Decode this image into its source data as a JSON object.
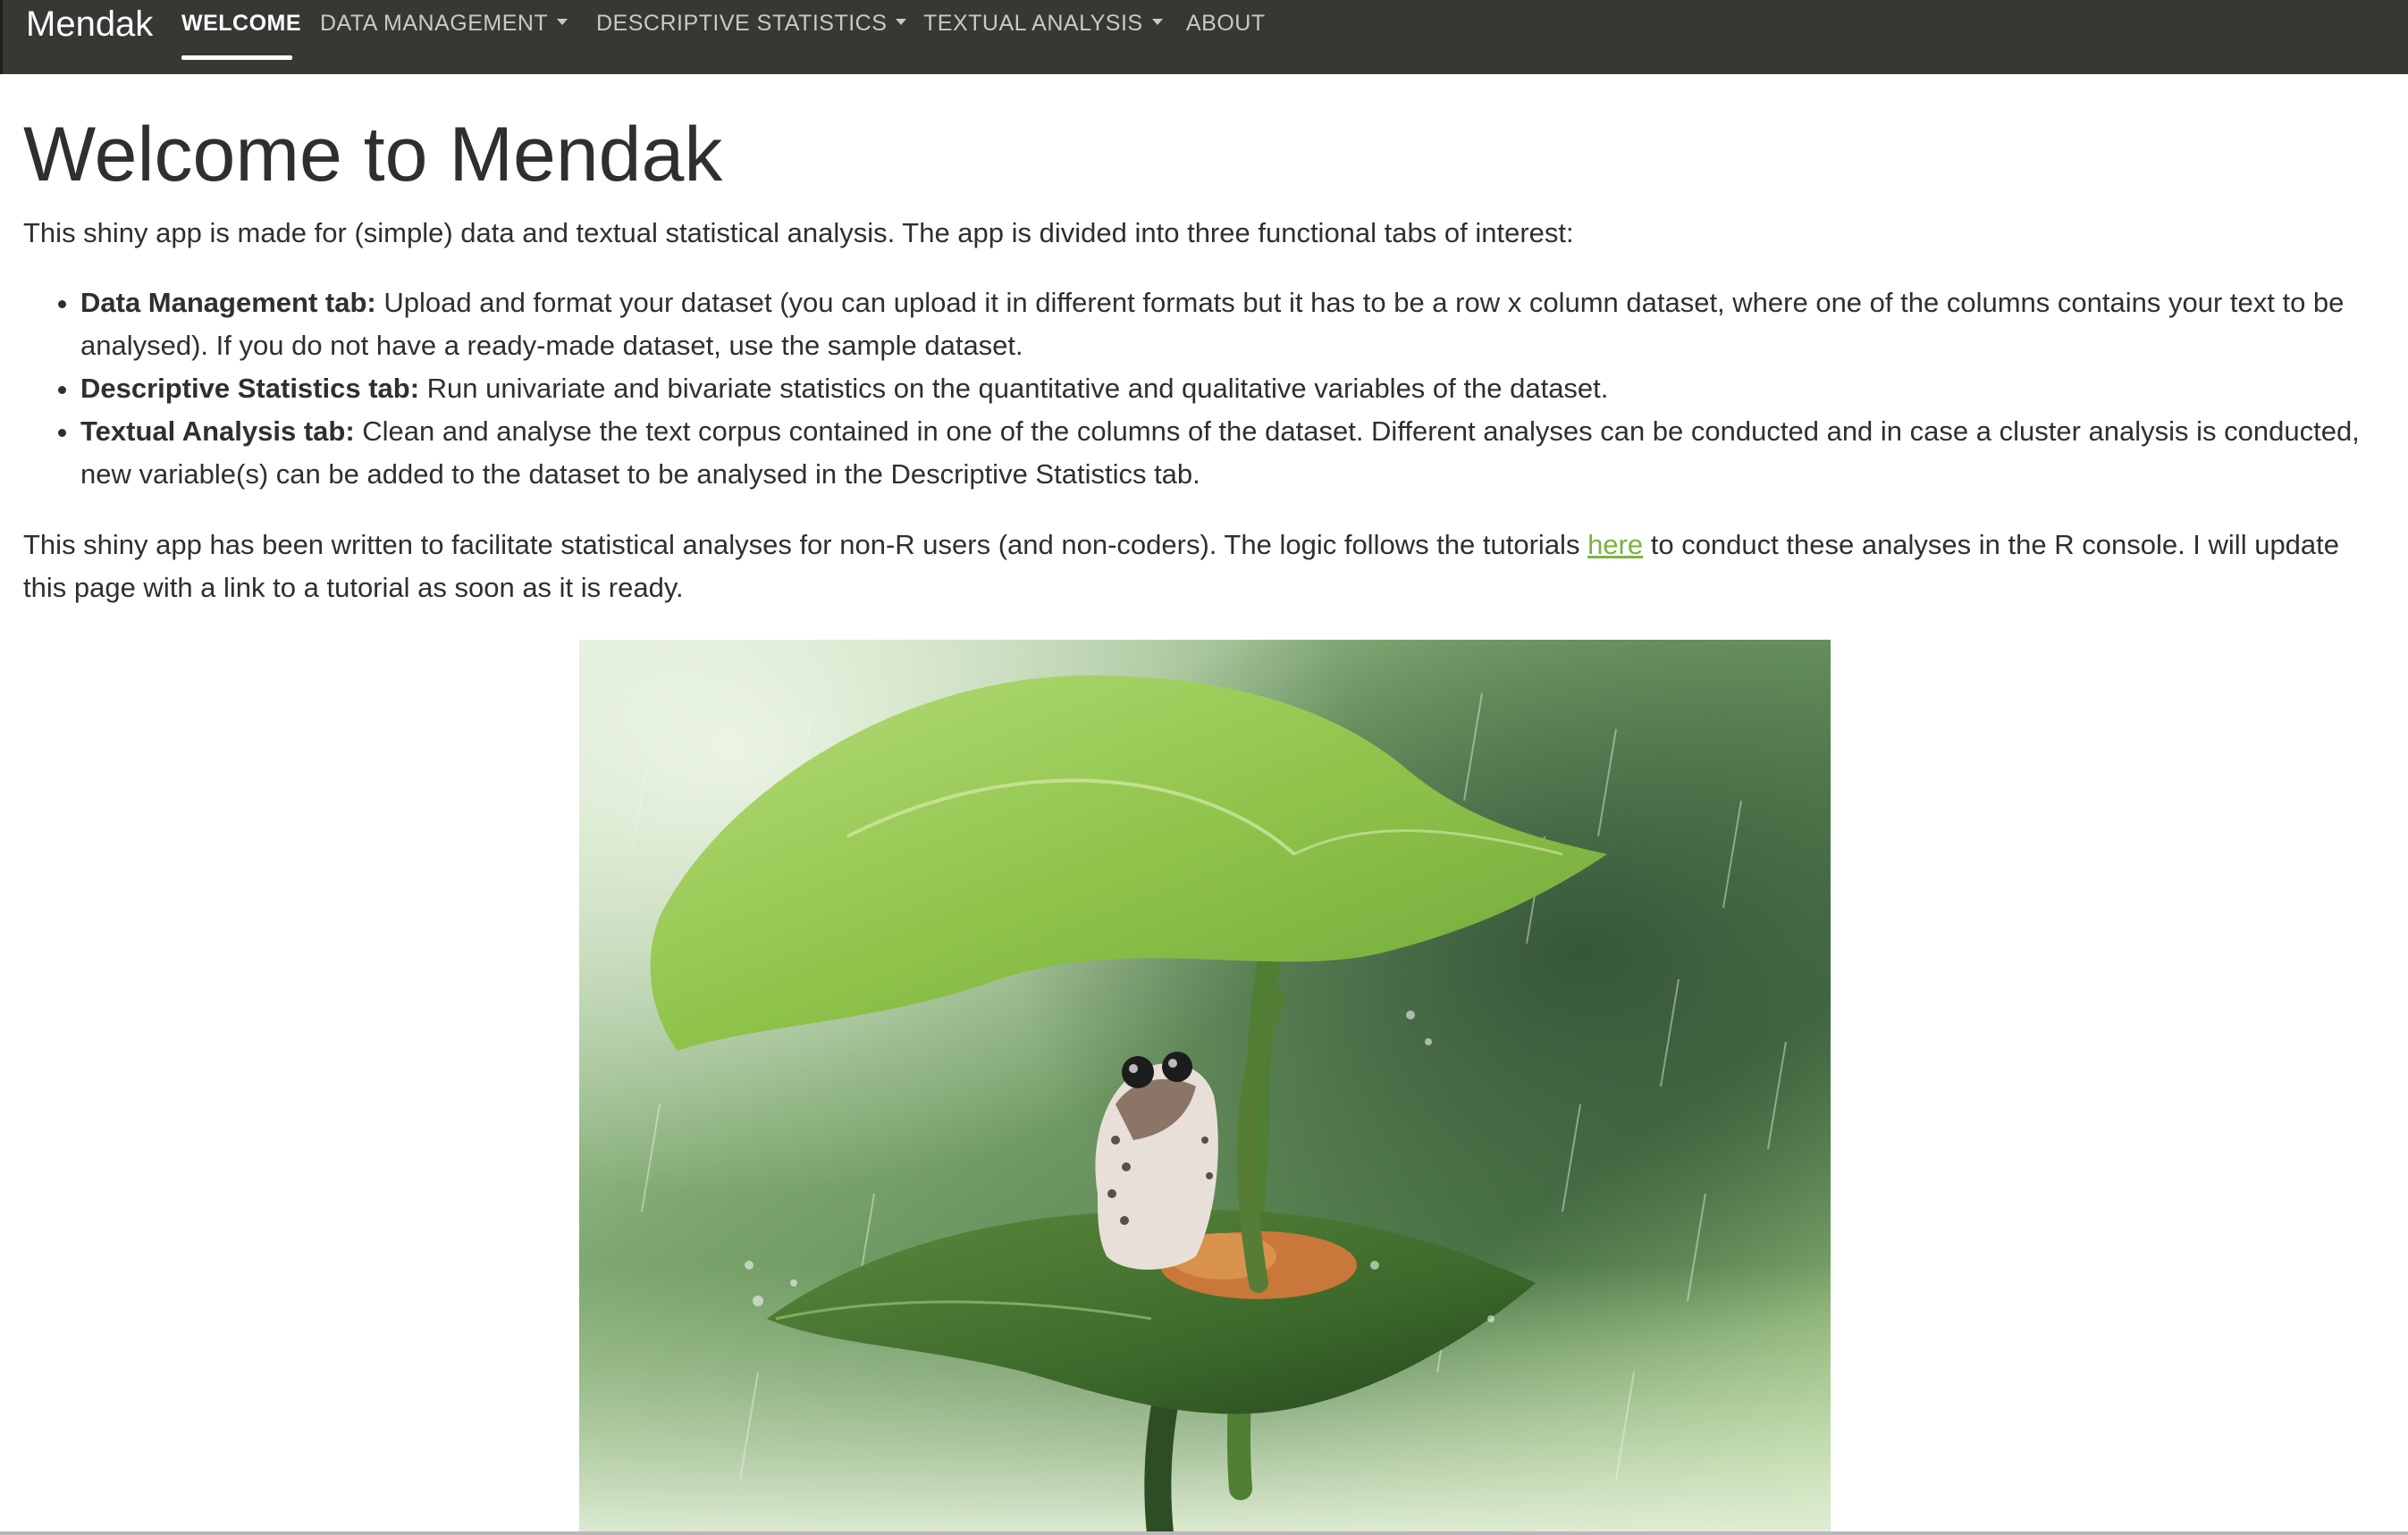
{
  "navbar": {
    "brand": "Mendak",
    "items": [
      {
        "label": "WELCOME",
        "active": true,
        "dropdown": false
      },
      {
        "label": "DATA MANAGEMENT",
        "active": false,
        "dropdown": true
      },
      {
        "label": "DESCRIPTIVE STATISTICS",
        "active": false,
        "dropdown": true
      },
      {
        "label": "TEXTUAL ANALYSIS",
        "active": false,
        "dropdown": true
      },
      {
        "label": "ABOUT",
        "active": false,
        "dropdown": false
      }
    ]
  },
  "main": {
    "title": "Welcome to Mendak",
    "intro": "This shiny app is made for (simple) data and textual statistical analysis. The app is divided into three functional tabs of interest:",
    "features": [
      {
        "name": "Data Management tab:",
        "text": " Upload and format your dataset (you can upload it in different formats but it has to be a row x column dataset, where one of the columns contains your text to be analysed). If you do not have a ready-made dataset, use the sample dataset."
      },
      {
        "name": "Descriptive Statistics tab:",
        "text": " Run univariate and bivariate statistics on the quantitative and qualitative variables of the dataset."
      },
      {
        "name": "Textual Analysis tab:",
        "text": " Clean and analyse the text corpus contained in one of the columns of the dataset. Different analyses can be conducted and in case a cluster analysis is conducted, new variable(s) can be added to the dataset to be analysed in the Descriptive Statistics tab."
      }
    ],
    "outro_before": "This shiny app has been written to facilitate statistical analyses for non-R users (and non-coders). The logic follows the tutorials ",
    "outro_link": "here",
    "outro_after": " to conduct these analyses in the R console. I will update this page with a link to a tutorial as soon as it is ready."
  },
  "colors": {
    "navbar_bg": "#373834",
    "link": "#7cb342",
    "text": "#2f2f2f"
  }
}
